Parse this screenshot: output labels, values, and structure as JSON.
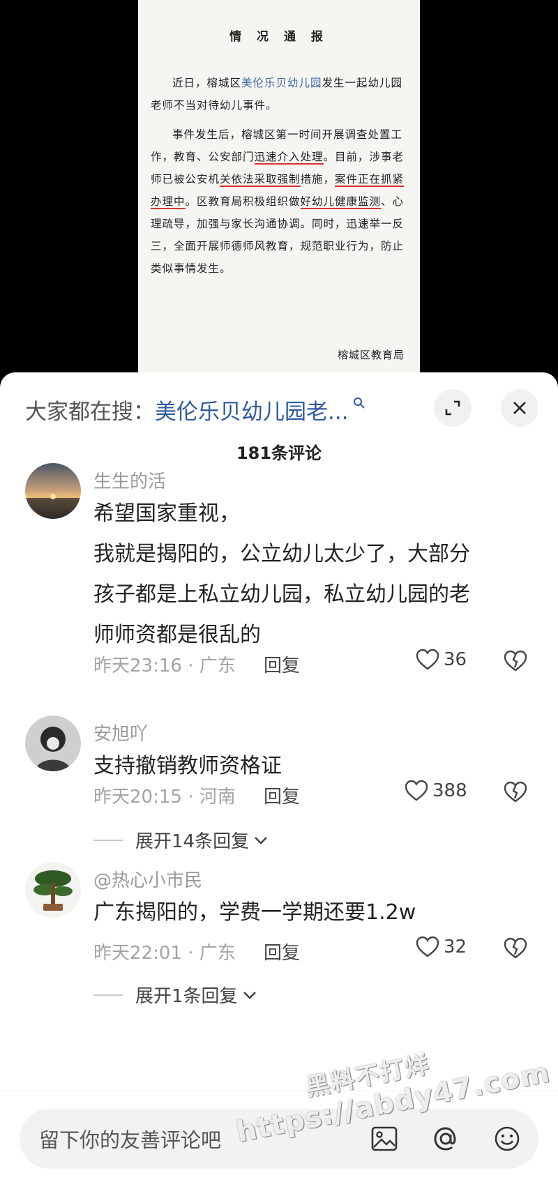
{
  "document": {
    "title": "情 况 通 报",
    "p1_pre": "近日，榕城区",
    "p1_link": "美伦乐贝幼儿园",
    "p1_post": "发生一起幼儿园老师不当对待幼儿事件。",
    "p2_a": "事件发生后，榕城区第一时间开展调查处置工作，教育、公安部门",
    "p2_u1": "迅速介入处理",
    "p2_b": "。目前，涉事老师已被公安机",
    "p2_u2": "关依法采取强制",
    "p2_c": "措施，",
    "p2_u3": "案件正在抓紧办理中",
    "p2_d": "。区教育局积极组织做",
    "p2_u4": "好幼儿健康监测",
    "p2_e": "、心理疏导，加强与家长沟通协调。同时，迅速举一反三，全面开展师德师风教育，规范职业行为，防止类似事情发生。",
    "signature": "榕城区教育局"
  },
  "header": {
    "search_prefix": "大家都在搜：",
    "search_term": "美伦乐贝幼儿园老...",
    "comment_count": "181条评论"
  },
  "comments": [
    {
      "user": "生生的活",
      "text_lines": [
        "希望国家重视，",
        "我就是揭阳的，公立幼儿太少了，大部分",
        "孩子都是上私立幼儿园，私立幼儿园的老",
        "师师资都是很乱的"
      ],
      "meta": "昨天23:16 · 广东",
      "reply": "回复",
      "likes": "36"
    },
    {
      "user": "安旭吖",
      "text_lines": [
        "支持撤销教师资格证"
      ],
      "meta": "昨天20:15 · 河南",
      "reply": "回复",
      "likes": "388",
      "expand": "展开14条回复"
    },
    {
      "user": "@热心小市民",
      "text_lines": [
        "广东揭阳的，学费一学期还要1.2w"
      ],
      "meta": "昨天22:01 · 广东",
      "reply": "回复",
      "likes": "32",
      "expand": "展开1条回复"
    }
  ],
  "input": {
    "placeholder": "留下你的友善评论吧"
  },
  "watermark": {
    "line1": "黑料不打烊",
    "line2": "https://abdy47.com"
  },
  "colors": {
    "link": "#2f5a9e",
    "underline": "#dd3333",
    "meta": "#a3a3a3"
  }
}
